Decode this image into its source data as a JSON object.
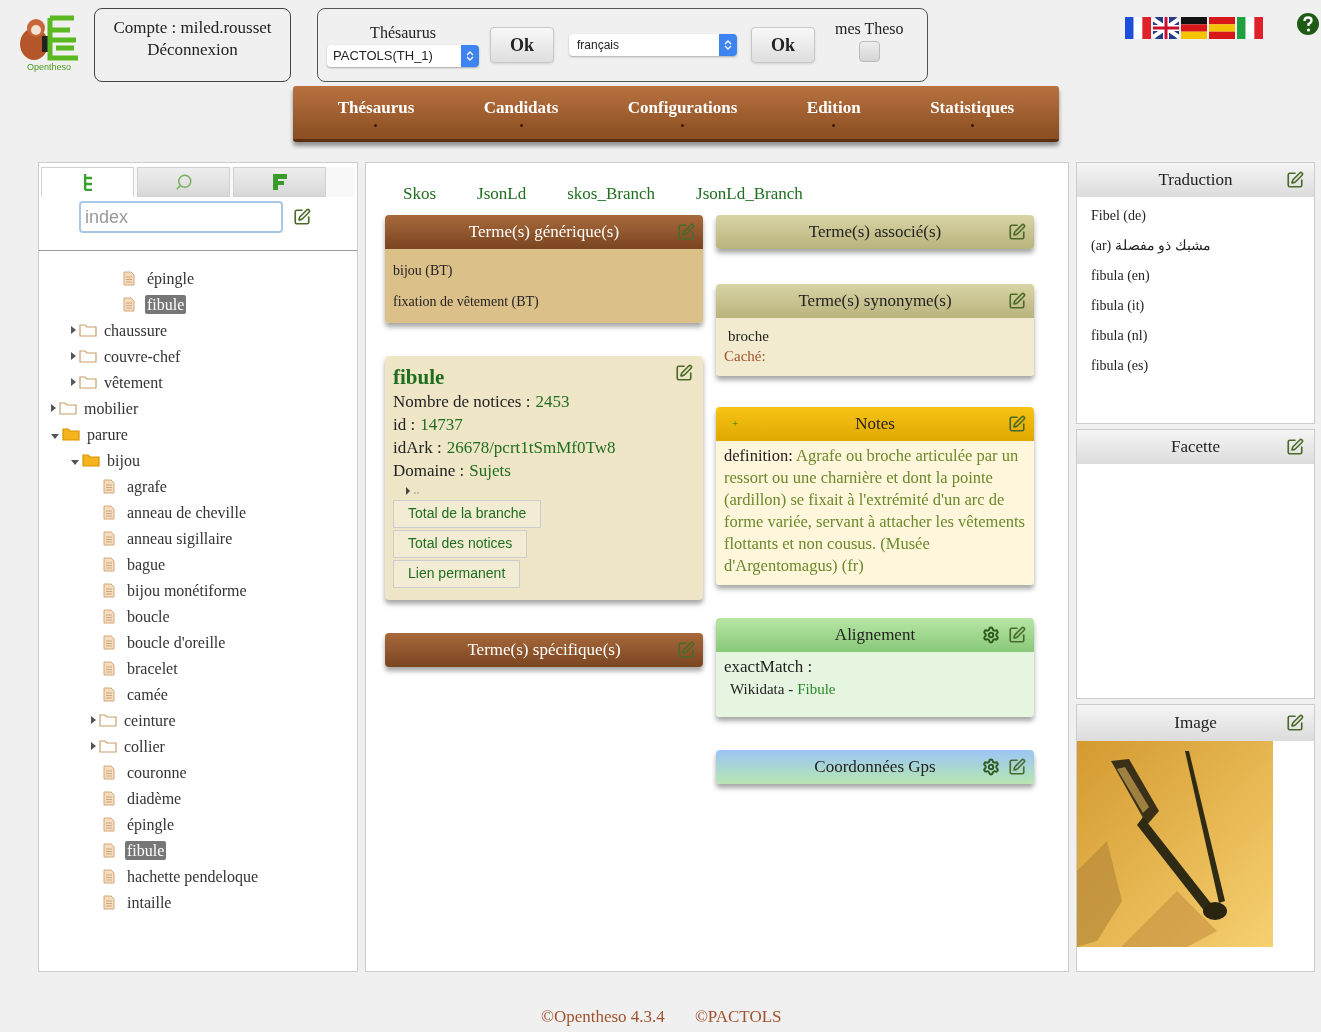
{
  "logo": {
    "text": "Opentheso"
  },
  "account": {
    "user": "Compte : miled.rousset",
    "logout": "Déconnexion"
  },
  "thesaurus_selector": {
    "label": "Thésaurus",
    "value": "PACTOLS(TH_1)",
    "ok": "Ok"
  },
  "language_selector": {
    "value": "français",
    "ok": "Ok"
  },
  "my_theso": {
    "label": "mes Theso",
    "checked": false
  },
  "menu": [
    {
      "label": "Thésaurus"
    },
    {
      "label": "Candidats"
    },
    {
      "label": "Configurations"
    },
    {
      "label": "Edition"
    },
    {
      "label": "Statistiques"
    }
  ],
  "left_panel": {
    "tabs": [
      {
        "kind": "tree",
        "selected": true
      },
      {
        "kind": "search",
        "selected": false
      },
      {
        "kind": "facet",
        "selected": false
      }
    ],
    "index_field": {
      "placeholder": "index"
    },
    "tree": [
      {
        "children": [
          {
            "children": [
              {
                "children": [
                  {
                    "label": "épingle",
                    "kind": "leaf",
                    "selected": false
                  },
                  {
                    "label": "fibule",
                    "kind": "leaf",
                    "selected": true
                  }
                ]
              }
            ]
          },
          {
            "label": "chaussure",
            "kind": "folder",
            "expanded": false,
            "selected": false
          },
          {
            "label": "couvre-chef",
            "kind": "folder",
            "expanded": false,
            "selected": false
          },
          {
            "label": "vêtement",
            "kind": "folder",
            "expanded": false,
            "selected": false
          }
        ]
      },
      {
        "label": "mobilier",
        "kind": "folder",
        "expanded": false,
        "selected": false
      },
      {
        "label": "parure",
        "kind": "folder",
        "expanded": true,
        "selected": false,
        "children": [
          {
            "label": "bijou",
            "kind": "folder",
            "expanded": true,
            "selected": false,
            "children": [
              {
                "label": "agrafe",
                "kind": "leaf",
                "selected": false
              },
              {
                "label": "anneau de cheville",
                "kind": "leaf",
                "selected": false
              },
              {
                "label": "anneau sigillaire",
                "kind": "leaf",
                "selected": false
              },
              {
                "label": "bague",
                "kind": "leaf",
                "selected": false
              },
              {
                "label": "bijou monétiforme",
                "kind": "leaf",
                "selected": false
              },
              {
                "label": "boucle",
                "kind": "leaf",
                "selected": false
              },
              {
                "label": "boucle d'oreille",
                "kind": "leaf",
                "selected": false
              },
              {
                "label": "bracelet",
                "kind": "leaf",
                "selected": false
              },
              {
                "label": "camée",
                "kind": "leaf",
                "selected": false
              },
              {
                "label": "ceinture",
                "kind": "folder",
                "expanded": false,
                "selected": false
              },
              {
                "label": "collier",
                "kind": "folder",
                "expanded": false,
                "selected": false
              },
              {
                "label": "couronne",
                "kind": "leaf",
                "selected": false
              },
              {
                "label": "diadème",
                "kind": "leaf",
                "selected": false
              },
              {
                "label": "épingle",
                "kind": "leaf",
                "selected": false
              },
              {
                "label": "fibule",
                "kind": "leaf",
                "selected": true
              },
              {
                "label": "hachette pendeloque",
                "kind": "leaf",
                "selected": false
              },
              {
                "label": "intaille",
                "kind": "leaf",
                "selected": false
              }
            ]
          }
        ]
      }
    ]
  },
  "exports": [
    "Skos",
    "JsonLd",
    "skos_Branch",
    "JsonLd_Branch"
  ],
  "broader": {
    "title": "Terme(s) générique(s)",
    "items": [
      "bijou (BT)",
      "fixation de vêtement (BT)"
    ]
  },
  "concept": {
    "title": "fibule",
    "fields": [
      {
        "label": "Nombre de notices :",
        "value": "2453"
      },
      {
        "label": "id :",
        "value": "14737"
      },
      {
        "label": "idArk :",
        "value": "26678/pcrt1tSmMf0Tw8"
      },
      {
        "label": "Domaine :",
        "value": "Sujets"
      }
    ],
    "buttons": [
      "Total de la branche",
      "Total des notices",
      "Lien permanent"
    ]
  },
  "narrower": {
    "title": "Terme(s) spécifique(s)"
  },
  "related": {
    "title": "Terme(s) associé(s)"
  },
  "synonyms": {
    "title": "Terme(s) synonyme(s)",
    "items": [
      "broche"
    ],
    "hidden_label": "Caché:"
  },
  "notes": {
    "title": "Notes",
    "expand": "+",
    "label": "definition:",
    "text": "Agrafe ou broche articulée par un ressort ou une charnière et dont la pointe (ardillon) se fixait à l'extrémité d'un arc de forme variée, servant à attacher les vêtements flottants et non cousus. (Musée d'Argentomagus) (fr)"
  },
  "alignment": {
    "title": "Alignement",
    "match_label": "exactMatch :",
    "source": "Wikidata -",
    "target": "Fibule"
  },
  "gps": {
    "title": "Coordonnées Gps"
  },
  "translations": {
    "title": "Traduction",
    "items": [
      "Fibel (de)",
      "مشبك ذو مفصلة (ar)",
      "fibula (en)",
      "fibula (it)",
      "fibula (nl)",
      "fibula (es)"
    ]
  },
  "facets": {
    "title": "Facette"
  },
  "image": {
    "title": "Image",
    "kind": "picture"
  },
  "footer": [
    "©Opentheso 4.3.4",
    "©PACTOLS"
  ]
}
